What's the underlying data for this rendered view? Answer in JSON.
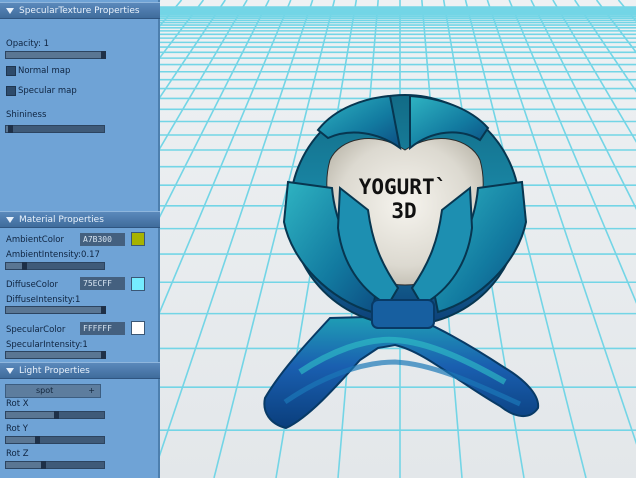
{
  "panel": {
    "specular_texture": {
      "header": "SpecularTexture Properties",
      "opacity_label": "Opacity: 1",
      "opacity_value": 1,
      "normal_map_label": "Normal map",
      "specular_map_label": "Specular map",
      "shininess_label": "Shininess",
      "shininess_value": 0.02
    },
    "material": {
      "header": "Material Properties",
      "ambient_color_label": "AmbientColor",
      "ambient_color_hex": "A7B300",
      "ambient_color": "#A7B300",
      "ambient_intensity_label": "AmbientIntensity:0.17",
      "ambient_intensity_value": 0.17,
      "diffuse_color_label": "DiffuseColor",
      "diffuse_color_hex": "75ECFF",
      "diffuse_color": "#75ECFF",
      "diffuse_intensity_label": "DiffuseIntensity:1",
      "diffuse_intensity_value": 1,
      "specular_color_label": "SpecularColor",
      "specular_color_hex": "FFFFFF",
      "specular_color": "#FFFFFF",
      "specular_intensity_label": "SpecularIntensity:1",
      "specular_intensity_value": 1
    },
    "light": {
      "header": "Light Properties",
      "type_selected": "spot",
      "dropdown_arrow": "+",
      "rot_x_label": "Rot X",
      "rot_x_value": 0.5,
      "rot_y_label": "Rot Y",
      "rot_y_value": 0.3,
      "rot_z_label": "Rot Z",
      "rot_z_value": 0.37
    }
  },
  "viewport": {
    "model_text_line1": "YOGURT`",
    "model_text_line2": "3D",
    "grid_color": "#73d5e6",
    "model_colors": [
      "#0a4f6e",
      "#1a86a8",
      "#2ab3b0",
      "#1c3f8c"
    ]
  }
}
